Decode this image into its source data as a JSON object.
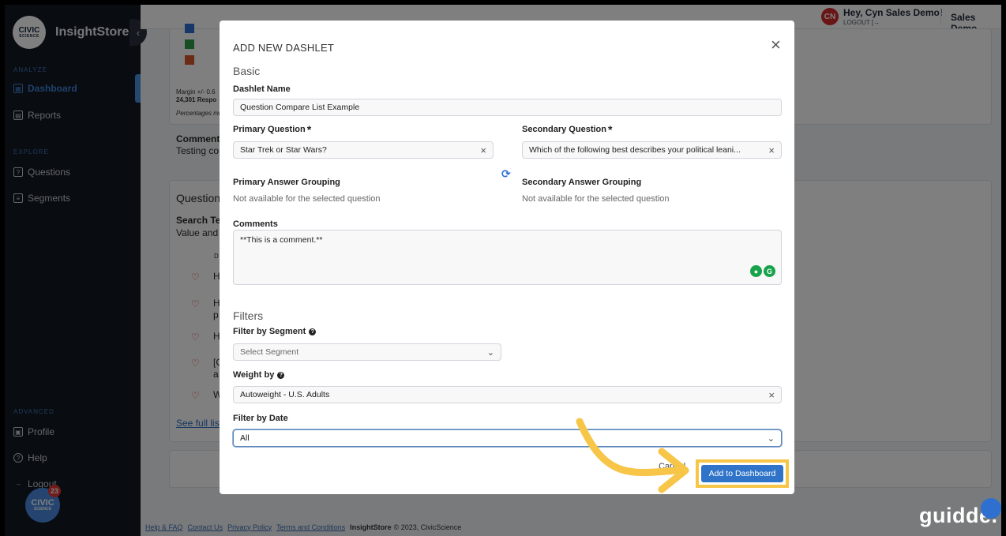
{
  "app": {
    "brand_name": "InsightStore",
    "logo_text": "CIVIC",
    "logo_subtext": "SCIENCE"
  },
  "sidebar": {
    "analyze_label": "ANALYZE",
    "dashboard": "Dashboard",
    "reports": "Reports",
    "explore_label": "EXPLORE",
    "questions": "Questions",
    "segments": "Segments",
    "advanced_label": "ADVANCED",
    "profile": "Profile",
    "help": "Help",
    "logout": "Logout",
    "badge_count": "23"
  },
  "topbar": {
    "avatar_initials": "CN",
    "greeting": "Hey, Cyn Sales Demo!",
    "logout": "LOGOUT",
    "account": "Sales Demo"
  },
  "background": {
    "margin_text": "Margin +/- 0.6",
    "responses_text": "24,301 Respo",
    "percent_text": "Percentages mu",
    "comments_label": "Comments",
    "comments_text": "Testing con",
    "question_heading": "Question",
    "search_label": "Search Ter",
    "search_value": "Value and F",
    "col_header": "D",
    "rows": [
      "H",
      "H",
      "p",
      "H",
      "[C",
      "a",
      "W"
    ],
    "see_full_list": "See full list",
    "legend_colors": [
      "#2f6fd1",
      "#2e9d4a",
      "#d9572c"
    ]
  },
  "footer": {
    "help": "Help & FAQ",
    "contact": "Contact Us",
    "privacy": "Privacy Policy",
    "terms": "Terms and Conditions",
    "copyright_brand": "InsightStore",
    "copyright": "© 2023, CivicScience"
  },
  "modal": {
    "title": "ADD NEW DASHLET",
    "basic_section": "Basic",
    "dashlet_name_label": "Dashlet Name",
    "dashlet_name_value": "Question Compare List Example",
    "primary_question_label": "Primary Question",
    "primary_question_value": "Star Trek or Star Wars?",
    "secondary_question_label": "Secondary Question",
    "secondary_question_value": "Which of the following best describes your political leani...",
    "required_mark": "*",
    "primary_grouping_label": "Primary Answer Grouping",
    "primary_grouping_note": "Not available for the selected question",
    "secondary_grouping_label": "Secondary Answer Grouping",
    "secondary_grouping_note": "Not available for the selected question",
    "comments_label": "Comments",
    "comments_value": "**This is a comment.**",
    "filters_section": "Filters",
    "segment_label": "Filter by Segment",
    "segment_placeholder": "Select Segment",
    "weight_label": "Weight by",
    "weight_value": "Autoweight - U.S. Adults",
    "date_label": "Filter by Date",
    "date_value": "All",
    "cancel": "Cancel",
    "add_button": "Add to Dashboard"
  },
  "watermark": "guidde.",
  "colors": {
    "accent": "#2f74c9",
    "highlight": "#f7c547",
    "sidebar_bg": "#121822"
  }
}
